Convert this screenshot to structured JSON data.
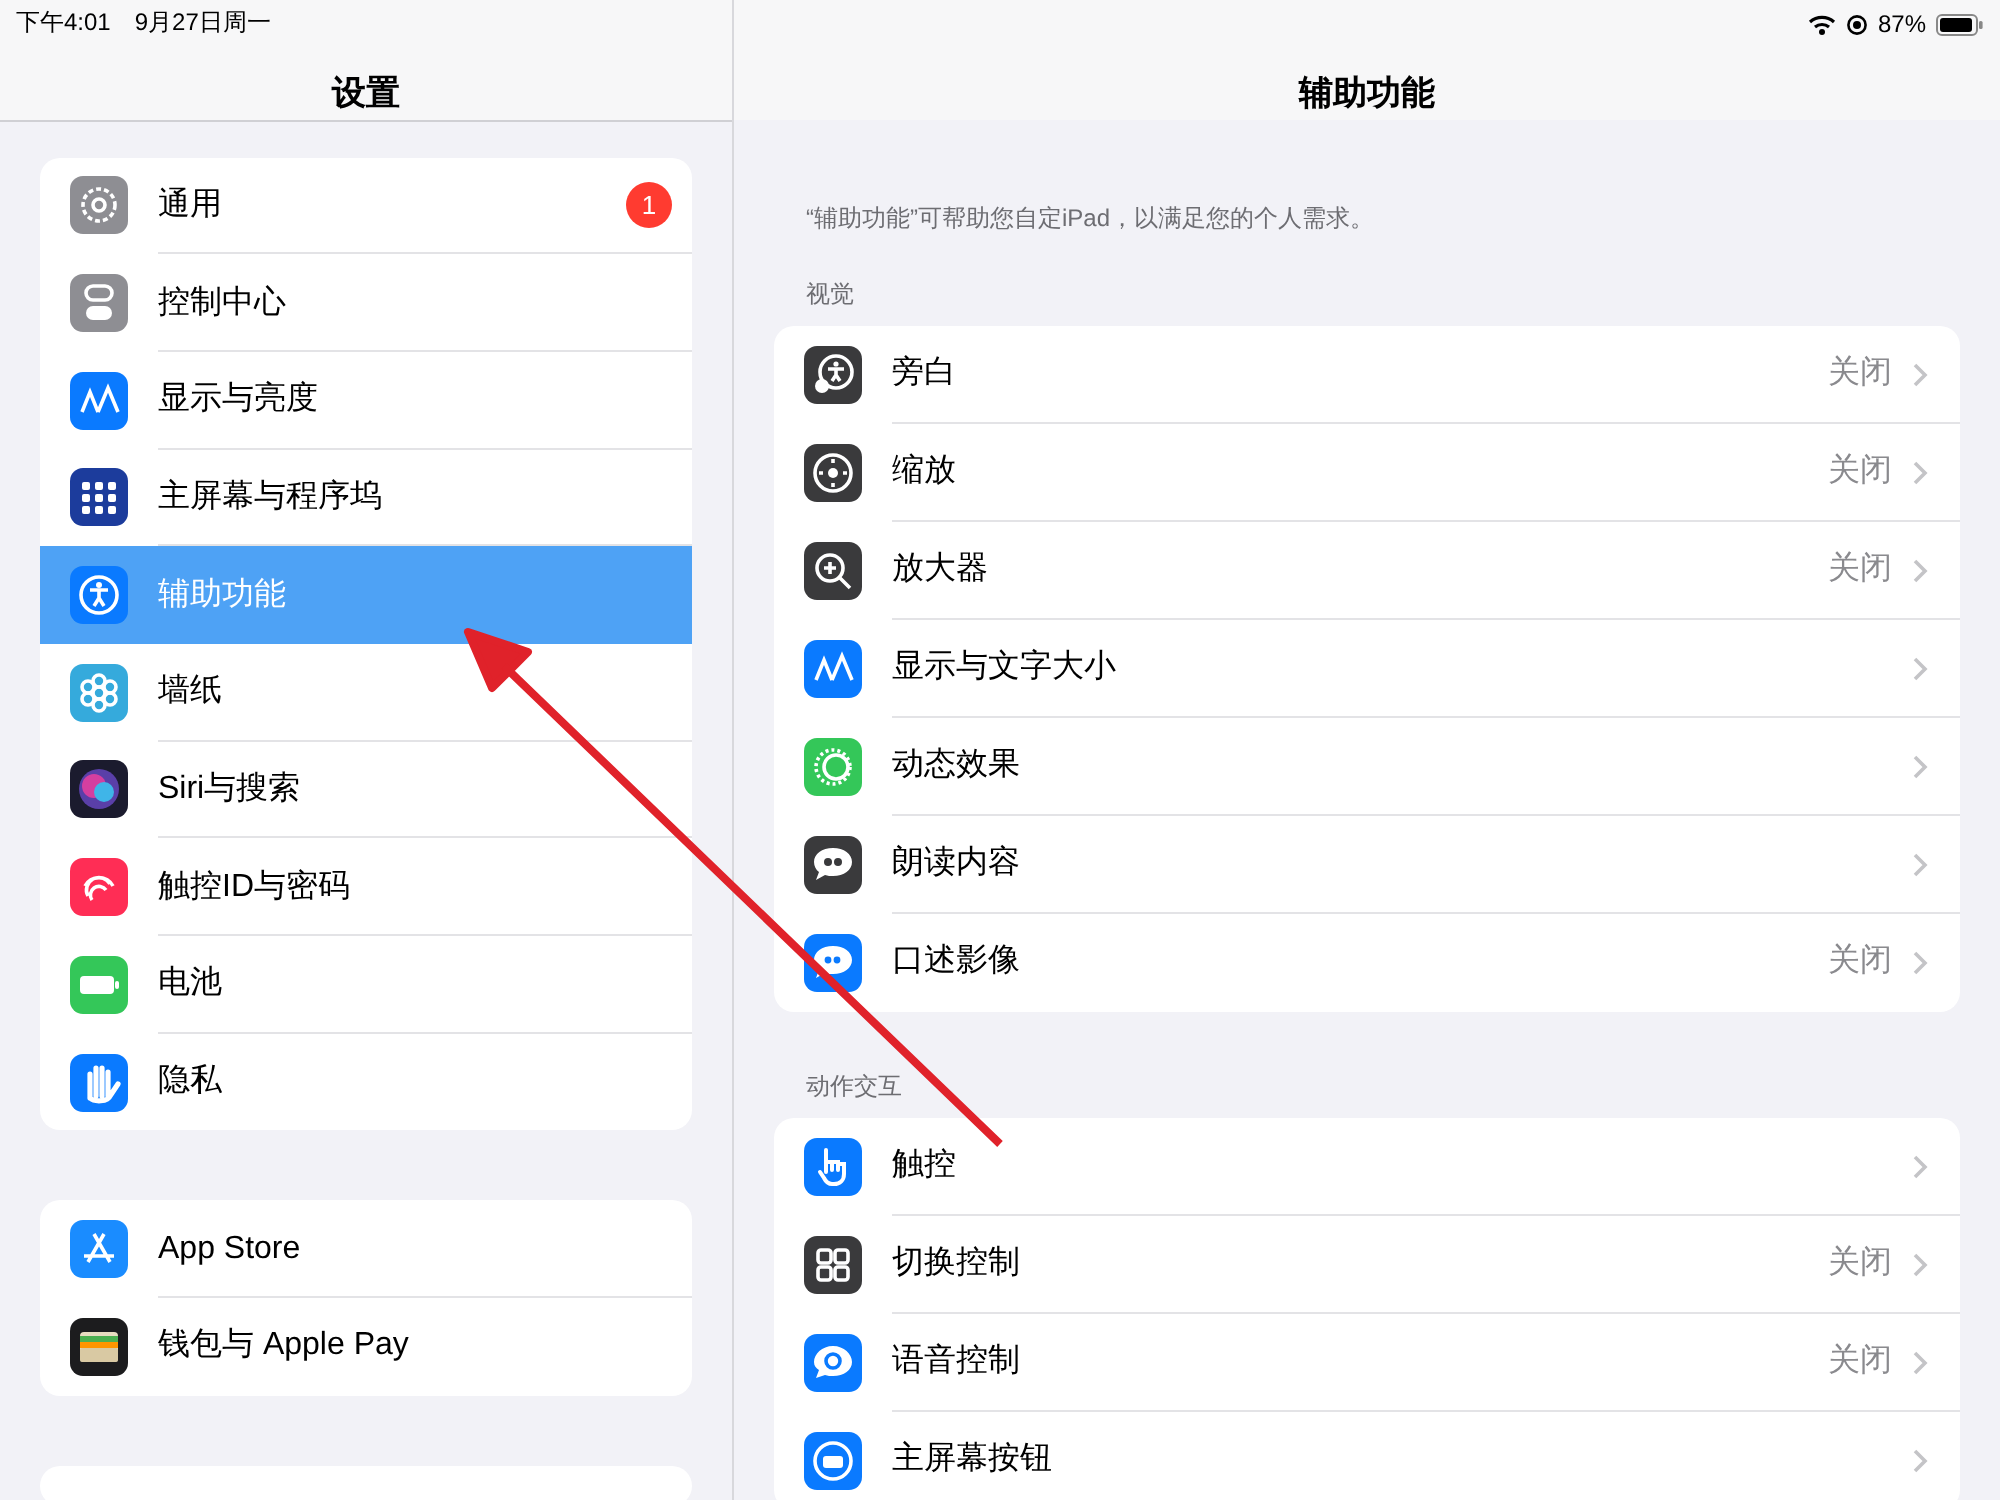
{
  "status_bar": {
    "time": "下午4:01",
    "date": "9月27日周一",
    "battery": "87%"
  },
  "sidebar": {
    "title": "设置",
    "groups": [
      {
        "items": [
          {
            "label": "通用",
            "badge": "1",
            "selected": false
          },
          {
            "label": "控制中心",
            "selected": false
          },
          {
            "label": "显示与亮度",
            "selected": false
          },
          {
            "label": "主屏幕与程序坞",
            "selected": false
          },
          {
            "label": "辅助功能",
            "selected": true
          },
          {
            "label": "墙纸",
            "selected": false
          },
          {
            "label": "Siri与搜索",
            "selected": false
          },
          {
            "label": "触控ID与密码",
            "selected": false
          },
          {
            "label": "电池",
            "selected": false
          },
          {
            "label": "隐私",
            "selected": false
          }
        ]
      },
      {
        "items": [
          {
            "label": "App Store",
            "selected": false
          },
          {
            "label": "钱包与 Apple Pay",
            "selected": false
          }
        ]
      }
    ]
  },
  "detail": {
    "title": "辅助功能",
    "description": "“辅助功能”可帮助您自定iPad，以满足您的个人需求。",
    "sections": [
      {
        "header": "视觉",
        "items": [
          {
            "label": "旁白",
            "value": "关闭"
          },
          {
            "label": "缩放",
            "value": "关闭"
          },
          {
            "label": "放大器",
            "value": "关闭"
          },
          {
            "label": "显示与文字大小"
          },
          {
            "label": "动态效果"
          },
          {
            "label": "朗读内容"
          },
          {
            "label": "口述影像",
            "value": "关闭"
          }
        ]
      },
      {
        "header": "动作交互",
        "items": [
          {
            "label": "触控"
          },
          {
            "label": "切换控制",
            "value": "关闭"
          },
          {
            "label": "语音控制",
            "value": "关闭"
          },
          {
            "label": "主屏幕按钮"
          }
        ]
      }
    ]
  }
}
